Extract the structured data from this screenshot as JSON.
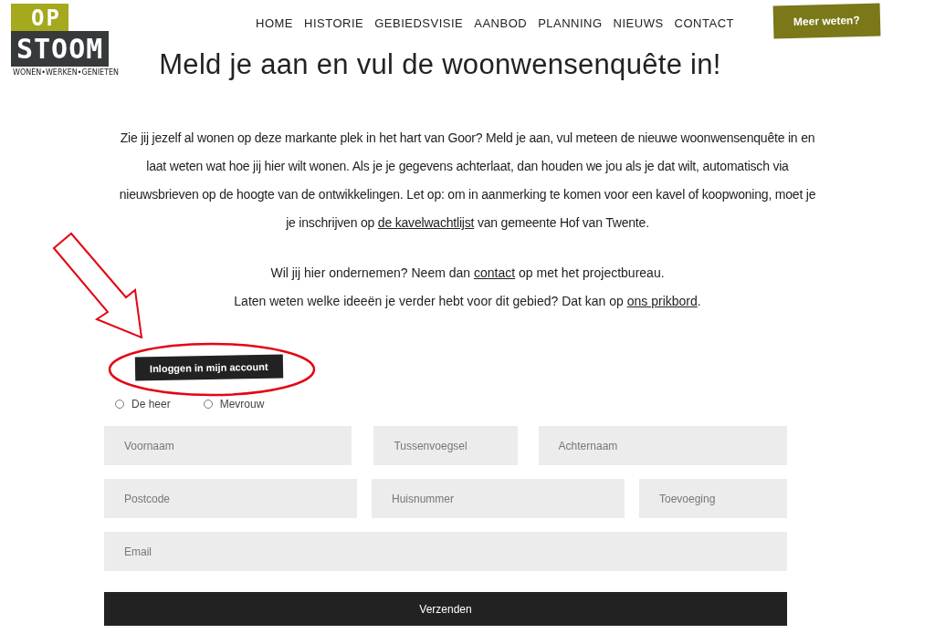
{
  "logo": {
    "top": "OP",
    "main": "STOOM",
    "tagline": "WONEN•WERKEN•GENIETEN"
  },
  "nav": [
    {
      "label": "HOME"
    },
    {
      "label": "HISTORIE"
    },
    {
      "label": "GEBIEDSVISIE"
    },
    {
      "label": "AANBOD"
    },
    {
      "label": "PLANNING"
    },
    {
      "label": "NIEUWS"
    },
    {
      "label": "CONTACT"
    }
  ],
  "cta": "Meer weten?",
  "title": "Meld je aan en vul de woonwensenquête in!",
  "intro": [
    {
      "kind": "text",
      "text": "Zie jij jezelf al wonen op deze markante plek in het hart van Goor? Meld je aan, vul meteen de nieuwe woonwensenquête in en laat weten wat hoe jij hier wilt wonen. Als je je gegevens achterlaat, dan houden we jou als je dat wilt, automatisch via nieuwsbrieven op de hoogte van de ontwikkelingen. Let op: om in aanmerking te komen voor een kavel of koopwoning, moet je je inschrijven op "
    },
    {
      "kind": "link",
      "text": "de kavelwachtlijst"
    },
    {
      "kind": "text",
      "text": " van gemeente Hof van Twente."
    }
  ],
  "lines": [
    [
      {
        "kind": "text",
        "text": "Wil jij hier ondernemen? Neem dan "
      },
      {
        "kind": "link",
        "text": "contact"
      },
      {
        "kind": "text",
        "text": " op met het projectbureau."
      }
    ],
    [
      {
        "kind": "text",
        "text": "Laten weten welke ideeën je verder hebt voor dit gebied? Dat kan op "
      },
      {
        "kind": "link",
        "text": "ons prikbord"
      },
      {
        "kind": "text",
        "text": "."
      }
    ]
  ],
  "login_button": "Inloggen in mijn account",
  "salutation": [
    {
      "label": "De heer",
      "selected": false
    },
    {
      "label": "Mevrouw",
      "selected": false
    }
  ],
  "field_rows": [
    [
      {
        "placeholder": "Voornaam"
      },
      {
        "placeholder": "Tussenvoegsel"
      },
      {
        "placeholder": "Achternaam"
      }
    ],
    [
      {
        "placeholder": "Postcode"
      },
      {
        "placeholder": "Huisnummer"
      },
      {
        "placeholder": "Toevoeging"
      }
    ],
    [
      {
        "placeholder": "Email"
      }
    ]
  ],
  "submit": "Verzenden"
}
